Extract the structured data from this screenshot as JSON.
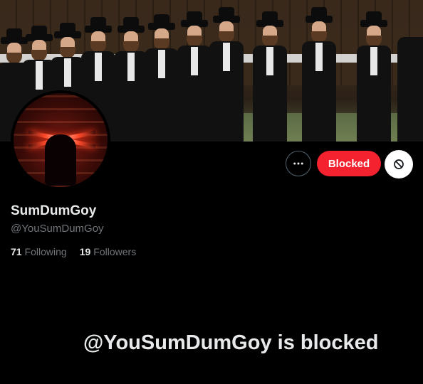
{
  "profile": {
    "display_name": "SumDumGoy",
    "handle": "@YouSumDumGoy",
    "following_count": "71",
    "following_label": "Following",
    "followers_count": "19",
    "followers_label": "Followers"
  },
  "actions": {
    "more_icon": "more-horizontal-icon",
    "blocked_label": "Blocked",
    "unblock_icon": "block-circle-icon"
  },
  "notice": {
    "title": "@YouSumDumGoy is blocked"
  },
  "colors": {
    "background": "#000000",
    "blocked_button": "#f4212e",
    "secondary_text": "#71767b",
    "primary_text": "#e7e9ea"
  }
}
